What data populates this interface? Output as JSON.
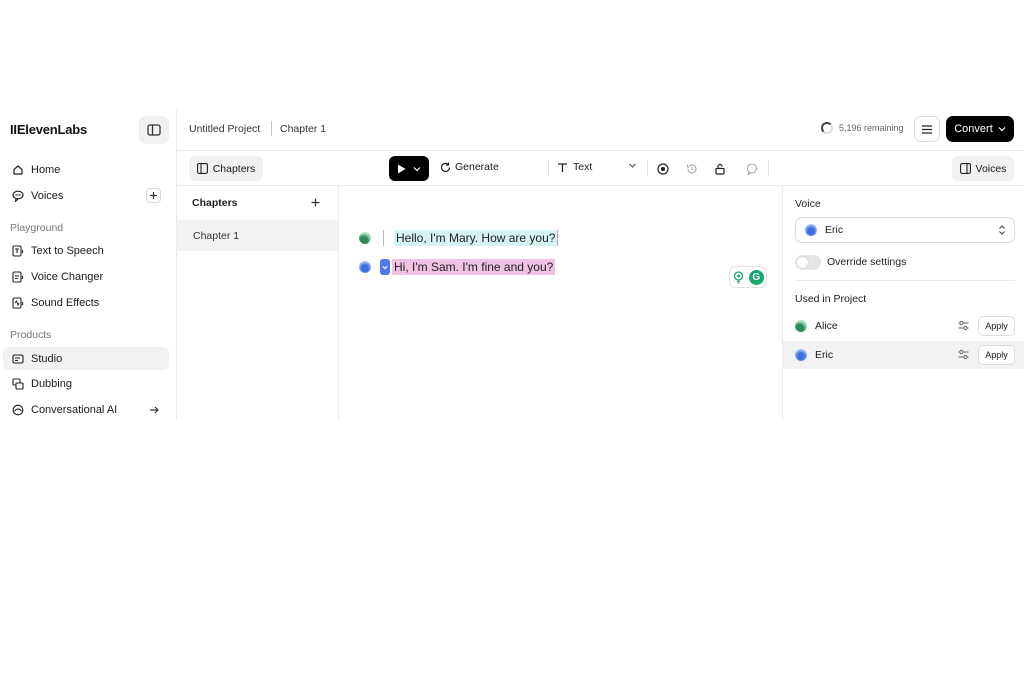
{
  "sidebar": {
    "logo": "IIElevenLabs",
    "nav": [
      {
        "label": "Home",
        "icon": "home-icon"
      },
      {
        "label": "Voices",
        "icon": "voices-icon"
      }
    ],
    "sections": [
      {
        "label": "Playground",
        "items": [
          {
            "label": "Text to Speech",
            "icon": "text-to-speech-icon"
          },
          {
            "label": "Voice Changer",
            "icon": "voice-changer-icon"
          },
          {
            "label": "Sound Effects",
            "icon": "sound-effects-icon"
          }
        ]
      },
      {
        "label": "Products",
        "items": [
          {
            "label": "Studio",
            "icon": "studio-icon",
            "active": true
          },
          {
            "label": "Dubbing",
            "icon": "dubbing-icon"
          },
          {
            "label": "Conversational AI",
            "icon": "conversational-ai-icon"
          }
        ]
      }
    ]
  },
  "header": {
    "project_title": "Untitled Project",
    "chapter_title": "Chapter 1",
    "remaining": "5,196 remaining",
    "convert_label": "Convert"
  },
  "toolbar": {
    "chapters_label": "Chapters",
    "generate_label": "Generate",
    "text_mode_label": "Text",
    "voices_label": "Voices"
  },
  "chapters_panel": {
    "title": "Chapters",
    "items": [
      "Chapter 1"
    ]
  },
  "editor": {
    "lines": [
      {
        "speaker": "Mary",
        "text": "Hello, I'm Mary. How are you?",
        "highlight": "#d6f3f4"
      },
      {
        "speaker": "Sam",
        "text": "Hi, I'm Sam. I'm fine and you?",
        "highlight": "#f0c3e4"
      }
    ]
  },
  "voices_panel": {
    "voice_label": "Voice",
    "selected_voice": "Eric",
    "override_label": "Override settings",
    "override_enabled": false,
    "used_title": "Used in Project",
    "used_voices": [
      {
        "name": "Alice",
        "apply_label": "Apply"
      },
      {
        "name": "Eric",
        "apply_label": "Apply",
        "selected": true
      }
    ]
  },
  "colors": {
    "accent": "#000000",
    "mary_highlight": "#d6f3f4",
    "sam_highlight": "#f0c3e4",
    "voice_blue": "#4d7be8",
    "grammarly_green": "#15a86b"
  }
}
